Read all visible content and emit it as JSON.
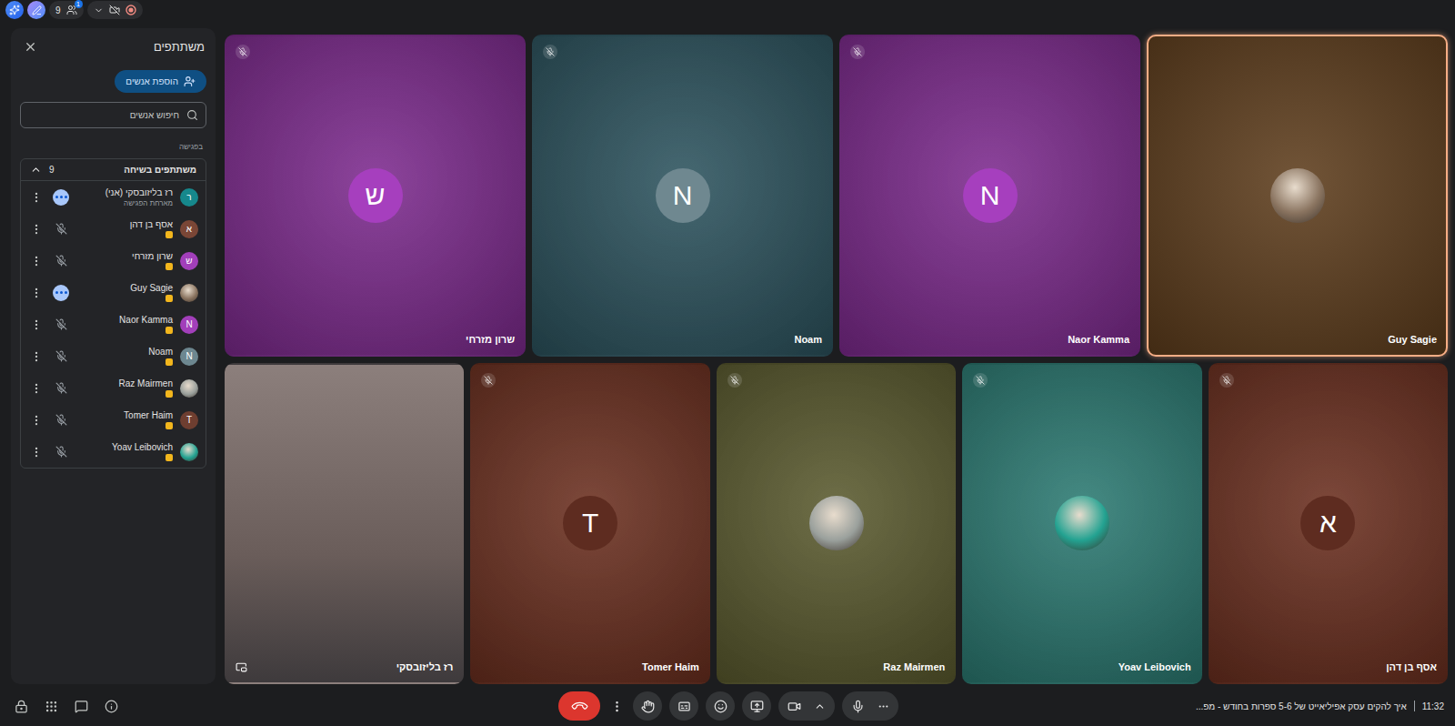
{
  "topbar": {
    "participant_count": "9",
    "notification_count": "1"
  },
  "panel": {
    "title": "משתתפים",
    "add_button": "הוספת אנשים",
    "search": {
      "placeholder": "חיפוש אנשים"
    },
    "section_label": "בפגישה",
    "group": {
      "title": "משתתפים בשיחה",
      "count": "9",
      "expanded": true
    },
    "participants": [
      {
        "name": "רז בליזובסקי (אני)",
        "subtitle": "מארחת הפגישה",
        "kind": "initial",
        "initial": "ר",
        "color": "#16888c",
        "status": "speaking",
        "badge": false
      },
      {
        "name": "אסף בן דהן",
        "kind": "initial",
        "initial": "א",
        "color": "#7a4636",
        "status": "muted",
        "badge": true
      },
      {
        "name": "שרון מזרחי",
        "kind": "initial",
        "initial": "ש",
        "color": "#a23fba",
        "status": "muted",
        "badge": true
      },
      {
        "name": "Guy Sagie",
        "kind": "photo",
        "color": "#8a7460",
        "status": "speaking",
        "badge": true
      },
      {
        "name": "Naor Kamma",
        "kind": "initial",
        "initial": "N",
        "color": "#a23fba",
        "status": "muted",
        "badge": true
      },
      {
        "name": "Noam",
        "kind": "initial",
        "initial": "N",
        "color": "#6d8790",
        "status": "muted",
        "badge": true
      },
      {
        "name": "Raz Mairmen",
        "kind": "photo",
        "color": "#9aa09c",
        "status": "muted",
        "badge": true
      },
      {
        "name": "Tomer Haim",
        "kind": "initial",
        "initial": "T",
        "color": "#6e3e30",
        "status": "muted",
        "badge": true
      },
      {
        "name": "Yoav Leibovich",
        "kind": "photo",
        "color": "#23a291",
        "status": "muted",
        "badge": true
      }
    ]
  },
  "tiles": [
    {
      "name": "שרון מזרחי",
      "kind": "initial",
      "initial": "ש",
      "color": "#7d2a8e",
      "avatar_color": "#a63fbe",
      "muted": true,
      "active": false
    },
    {
      "name": "Noam",
      "kind": "initial",
      "initial": "N",
      "color": "#2c535e",
      "avatar_color": "#6f8890",
      "muted": true,
      "active": false
    },
    {
      "name": "Naor Kamma",
      "kind": "initial",
      "initial": "N",
      "color": "#7d2a8e",
      "avatar_color": "#a63fbe",
      "muted": true,
      "active": false
    },
    {
      "name": "Guy Sagie",
      "kind": "photo",
      "color": "#5e3d1c",
      "avatar_color": "#8a7460",
      "muted": false,
      "active": true
    },
    {
      "name": "רז בליזובסקי",
      "kind": "video",
      "color": "#6a5d5a",
      "avatar_color": "#6a5d5a",
      "muted": false,
      "active": false
    },
    {
      "name": "Tomer Haim",
      "kind": "initial",
      "initial": "T",
      "color": "#6b2f1f",
      "avatar_color": "#5e2c20",
      "muted": true,
      "active": false
    },
    {
      "name": "Raz Mairmen",
      "kind": "photo",
      "color": "#5a5a2e",
      "avatar_color": "#9aa09c",
      "muted": true,
      "active": false
    },
    {
      "name": "Yoav Leibovich",
      "kind": "photo",
      "color": "#2b7a72",
      "avatar_color": "#23a291",
      "muted": true,
      "active": false
    },
    {
      "name": "אסף בן דהן",
      "kind": "initial",
      "initial": "א",
      "color": "#6b2f1f",
      "avatar_color": "#5e2c20",
      "muted": true,
      "active": false
    }
  ],
  "meeting": {
    "title": "איך להקים עסק אפיליאייט של 5-6 ספרות בחודש - מפ...",
    "time": "11:32"
  }
}
